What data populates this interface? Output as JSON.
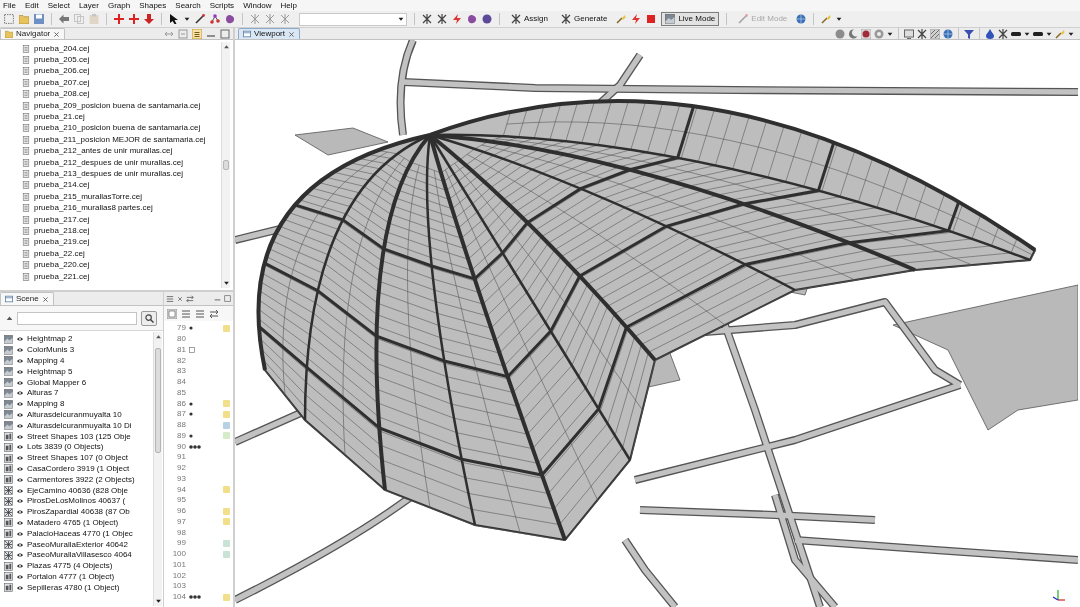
{
  "menu": [
    "File",
    "Edit",
    "Select",
    "Layer",
    "Graph",
    "Shapes",
    "Search",
    "Scripts",
    "Window",
    "Help"
  ],
  "toolbar": {
    "buttons": [
      {
        "label": "Assign",
        "on": false,
        "disabled": false
      },
      {
        "label": "Generate",
        "on": false,
        "disabled": false
      },
      {
        "label": "Live Mode",
        "on": true,
        "disabled": false
      },
      {
        "label": "Edit Mode",
        "on": false,
        "disabled": true
      }
    ]
  },
  "navigator": {
    "tab": {
      "label": "Navigator",
      "active": false
    },
    "items": [
      "prueba_204.cej",
      "prueba_205.cej",
      "prueba_206.cej",
      "prueba_207.cej",
      "prueba_208.cej",
      "prueba_209_posicion buena de santamaria.cej",
      "prueba_21.cej",
      "prueba_210_posicion buena de santamaria.cej",
      "prueba_211_posicion MEJOR de santamaria.cej",
      "prueba_212_antes de unir murallas.cej",
      "prueba_212_despues de unir murallas.cej",
      "prueba_213_despues de unir murallas.cej",
      "prueba_214.cej",
      "prueba_215_murallasTorre.cej",
      "prueba_216_murallas8 partes.cej",
      "prueba_217.cej",
      "prueba_218.cej",
      "prueba_219.cej",
      "prueba_22.cej",
      "prueba_220.cej",
      "prueba_221.cej"
    ]
  },
  "viewport": {
    "tab": {
      "label": "Viewport",
      "active": true
    }
  },
  "scene": {
    "tab": {
      "label": "Scene",
      "active": false
    },
    "items": [
      {
        "label": "Heightmap 2",
        "kind": "map",
        "visible": true
      },
      {
        "label": "ColorMunis 3",
        "kind": "map",
        "visible": true
      },
      {
        "label": "Mapping 4",
        "kind": "map",
        "visible": true
      },
      {
        "label": "Heightmap 5",
        "kind": "map",
        "visible": true
      },
      {
        "label": "Global Mapper 6",
        "kind": "map",
        "visible": true
      },
      {
        "label": "Alturas 7",
        "kind": "map",
        "visible": true
      },
      {
        "label": "Mapping 8",
        "kind": "map",
        "visible": true
      },
      {
        "label": "Alturasdelcuranmuyalta 10",
        "kind": "map",
        "visible": true
      },
      {
        "label": "Alturasdelcuranmuyalta 10 Di",
        "kind": "map",
        "visible": true
      },
      {
        "label": "Street Shapes 103 (125 Obje",
        "kind": "shapes",
        "visible": true
      },
      {
        "label": "Lots 3839 (0 Objects)",
        "kind": "shapes",
        "visible": true
      },
      {
        "label": "Street Shapes 107 (0 Object",
        "kind": "shapes",
        "visible": true
      },
      {
        "label": "CasaCordero 3919 (1 Object",
        "kind": "shapes",
        "visible": true
      },
      {
        "label": "Carmentores 3922 (2 Objects)",
        "kind": "shapes",
        "visible": true
      },
      {
        "label": "EjeCamino 40636 (828 Obje",
        "kind": "network",
        "visible": true
      },
      {
        "label": "PirosDeLosMolinos 40637 (",
        "kind": "network",
        "visible": true
      },
      {
        "label": "PirosZapardial 40638 (87 Ob",
        "kind": "network",
        "visible": true
      },
      {
        "label": "Matadero 4765 (1 Object)",
        "kind": "shapes",
        "visible": true
      },
      {
        "label": "PalacioHaceas 4770 (1 Objec",
        "kind": "shapes",
        "visible": true
      },
      {
        "label": "PaseoMurallaExterior 40642",
        "kind": "network",
        "visible": true
      },
      {
        "label": "PaseoMurallaVillasesco 4064",
        "kind": "network",
        "visible": true
      },
      {
        "label": "Plazas 4775 (4 Objects)",
        "kind": "shapes",
        "visible": true
      },
      {
        "label": "Portalon 4777 (1 Object)",
        "kind": "shapes",
        "visible": true
      },
      {
        "label": "Sepilleras 4780 (1 Object)",
        "kind": "shapes",
        "visible": true
      }
    ]
  },
  "script_panel": {
    "lines": [
      {
        "number": "79",
        "kind": "dot",
        "color": "#f1df8c"
      },
      {
        "number": "80",
        "kind": "plain"
      },
      {
        "number": "81",
        "kind": "box"
      },
      {
        "number": "82",
        "kind": "plain"
      },
      {
        "number": "83",
        "kind": "plain"
      },
      {
        "number": "84",
        "kind": "plain"
      },
      {
        "number": "85",
        "kind": "plain"
      },
      {
        "number": "86",
        "kind": "dot",
        "color": "#f1df8c"
      },
      {
        "number": "87",
        "kind": "dot",
        "color": "#f1df8c"
      },
      {
        "number": "88",
        "kind": "plain",
        "color": "#b8d2e4"
      },
      {
        "number": "89",
        "kind": "dot",
        "color": "#d6ebc8"
      },
      {
        "number": "90",
        "kind": "dots"
      },
      {
        "number": "91",
        "kind": "plain"
      },
      {
        "number": "92",
        "kind": "plain"
      },
      {
        "number": "93",
        "kind": "plain"
      },
      {
        "number": "94",
        "kind": "plain",
        "color": "#f1df8c"
      },
      {
        "number": "95",
        "kind": "plain"
      },
      {
        "number": "96",
        "kind": "plain",
        "color": "#f1df8c"
      },
      {
        "number": "97",
        "kind": "plain",
        "color": "#f1df8c"
      },
      {
        "number": "98",
        "kind": "plain"
      },
      {
        "number": "99",
        "kind": "plain",
        "color": "#c9e4d6"
      },
      {
        "number": "100",
        "kind": "plain",
        "color": "#c9e4d6"
      },
      {
        "number": "101",
        "kind": "plain"
      },
      {
        "number": "102",
        "kind": "plain"
      },
      {
        "number": "103",
        "kind": "plain"
      },
      {
        "number": "104",
        "kind": "dots",
        "color": "#f1df8c"
      }
    ]
  }
}
